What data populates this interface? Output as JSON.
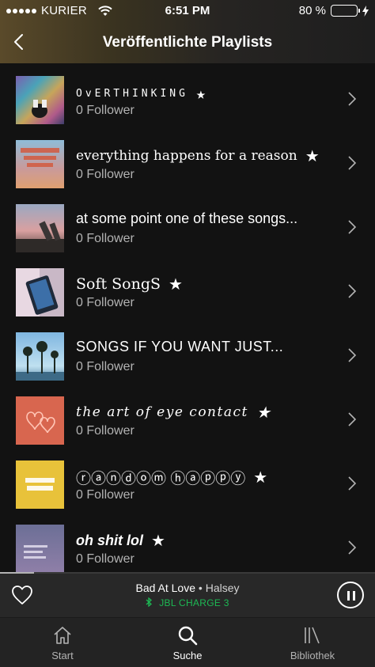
{
  "status_bar": {
    "carrier": "KURIER",
    "time": "6:51 PM",
    "battery_percent": "80 %",
    "battery_level": 0.8,
    "battery_color": "#4cd964"
  },
  "header": {
    "back_icon": "chevron-left-icon",
    "title": "Veröffentlichte Playlists"
  },
  "playlists": [
    {
      "name": "OvERTHINKING",
      "star": "★",
      "followers": "0 Follower"
    },
    {
      "name": "everything happens for a reason",
      "star": "★",
      "followers": "0 Follower"
    },
    {
      "name": "at some point one of these songs...",
      "star": "",
      "followers": "0 Follower"
    },
    {
      "name": "Soft SongS",
      "star": "★",
      "followers": "0 Follower"
    },
    {
      "name": "SONGS IF YOU WANT JUST...",
      "star": "",
      "followers": "0 Follower"
    },
    {
      "name": "the art of eye contact",
      "star": "★",
      "followers": "0 Follower"
    },
    {
      "name": "ⓡⓐⓝⓓⓞⓜ ⓗⓐⓟⓟⓨ",
      "star": "★",
      "followers": "0 Follower"
    },
    {
      "name": "oh shit lol",
      "star": "★",
      "followers": "0 Follower"
    }
  ],
  "now_playing": {
    "title": "Bad At Love",
    "separator": " • ",
    "artist": "Halsey",
    "device": "JBL CHARGE 3",
    "device_icon": "bluetooth-icon",
    "progress": 0.09,
    "accent_color": "#1db954"
  },
  "tab_bar": {
    "items": [
      {
        "label": "Start",
        "icon": "home-icon"
      },
      {
        "label": "Suche",
        "icon": "search-icon",
        "active": true
      },
      {
        "label": "Bibliothek",
        "icon": "library-icon"
      }
    ]
  }
}
